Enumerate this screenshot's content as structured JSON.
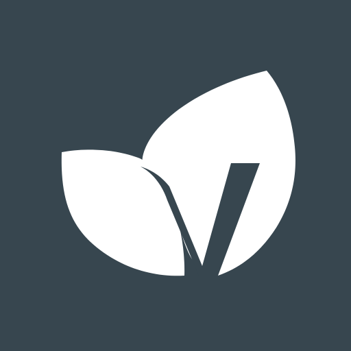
{
  "icon": {
    "name": "leaf-v-logo-icon",
    "background_color": "#37464f",
    "foreground_color": "#ffffff",
    "description_shape": "two leaves forming a V"
  }
}
